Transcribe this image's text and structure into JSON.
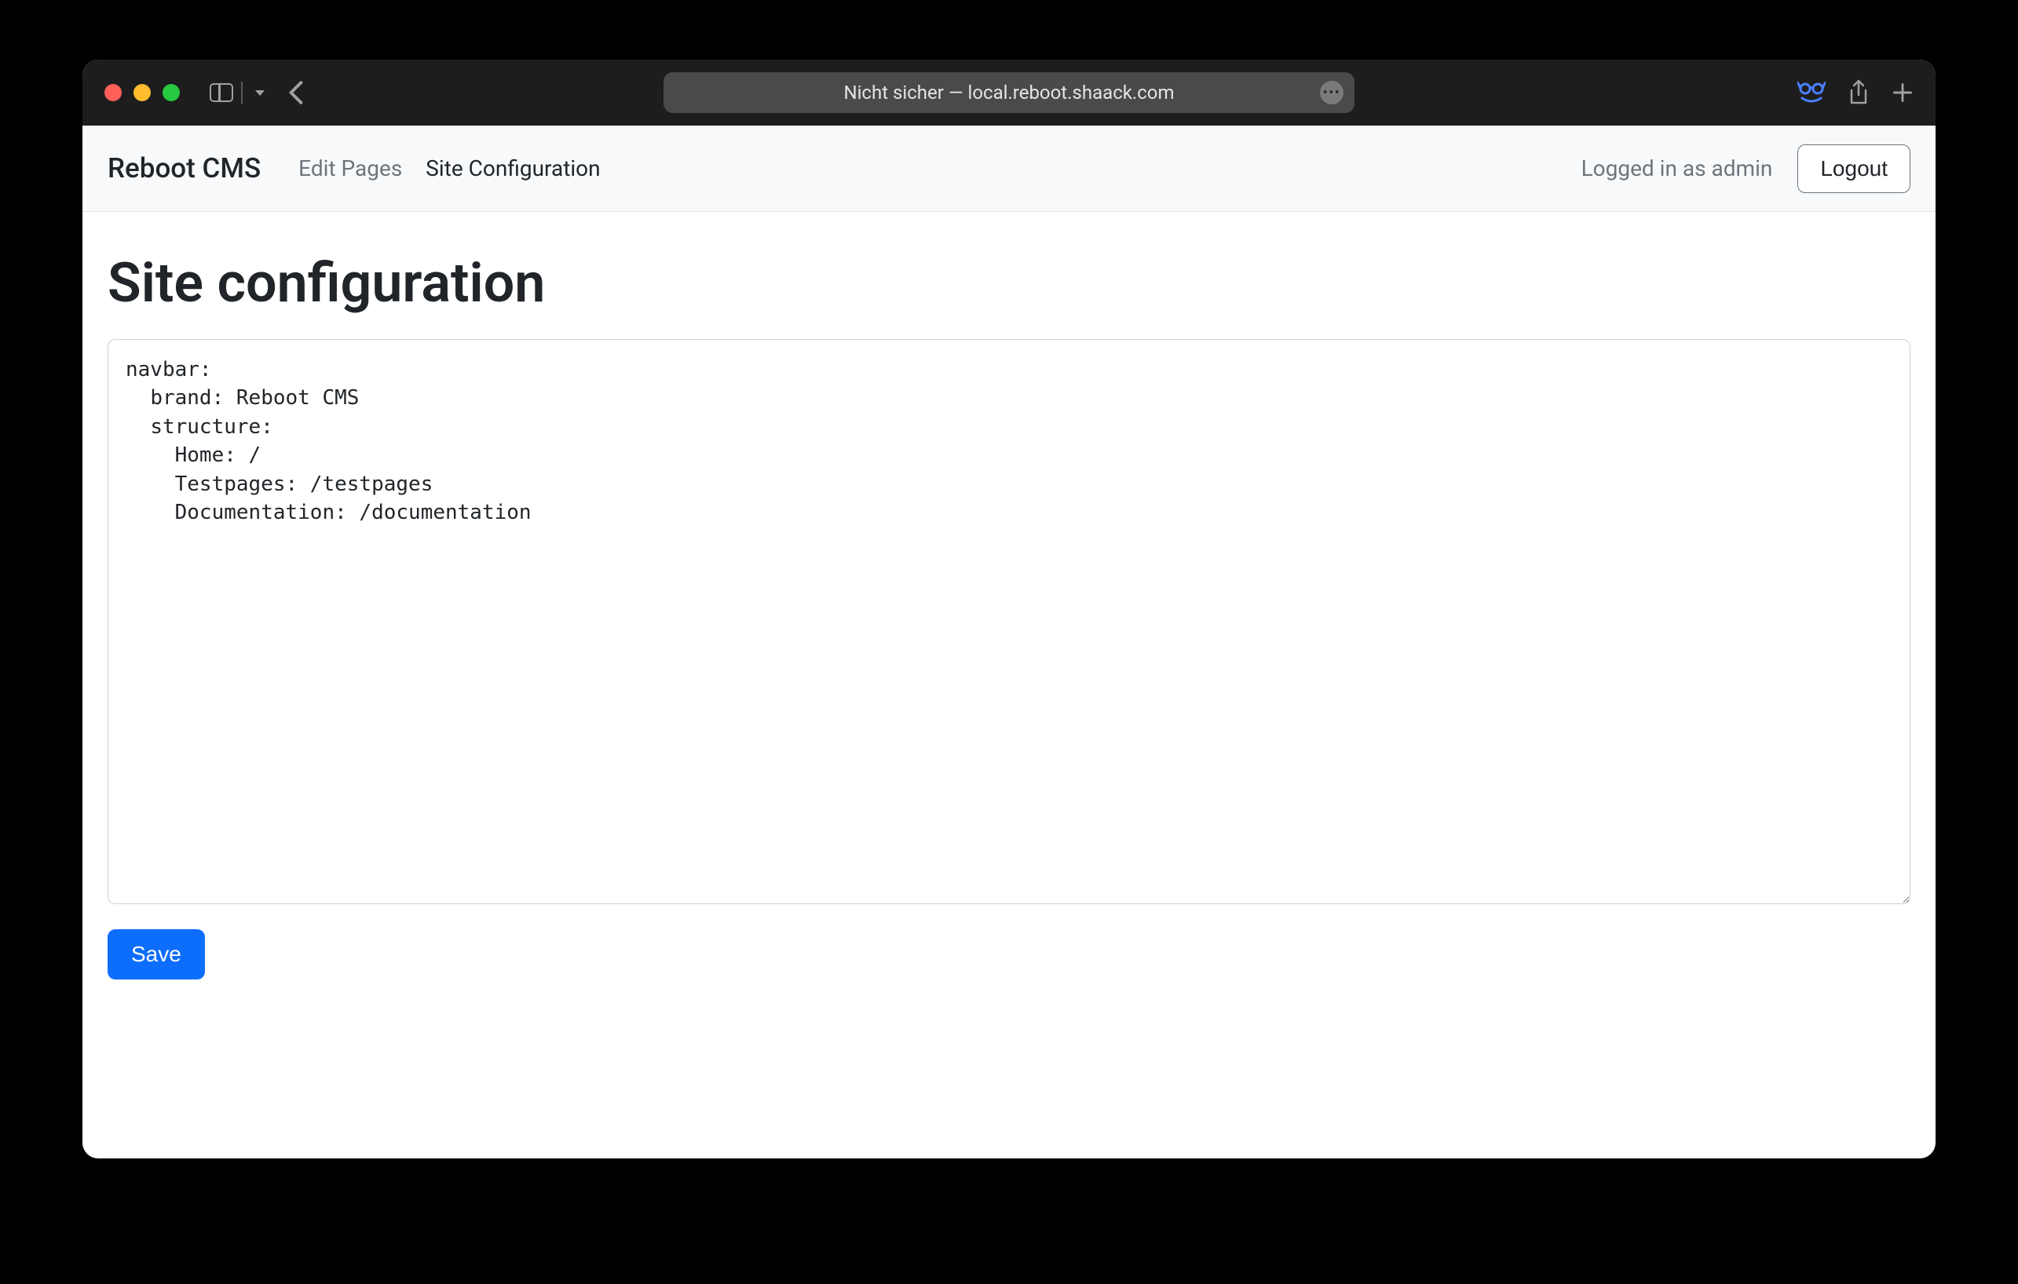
{
  "browser": {
    "address_bar": "Nicht sicher — local.reboot.shaack.com"
  },
  "navbar": {
    "brand": "Reboot CMS",
    "items": [
      {
        "label": "Edit Pages",
        "active": false
      },
      {
        "label": "Site Configuration",
        "active": true
      }
    ],
    "login_status": "Logged in as admin",
    "logout_label": "Logout"
  },
  "page": {
    "title": "Site configuration",
    "config_value": "navbar:\n  brand: Reboot CMS\n  structure:\n    Home: /\n    Testpages: /testpages\n    Documentation: /documentation",
    "save_label": "Save"
  }
}
